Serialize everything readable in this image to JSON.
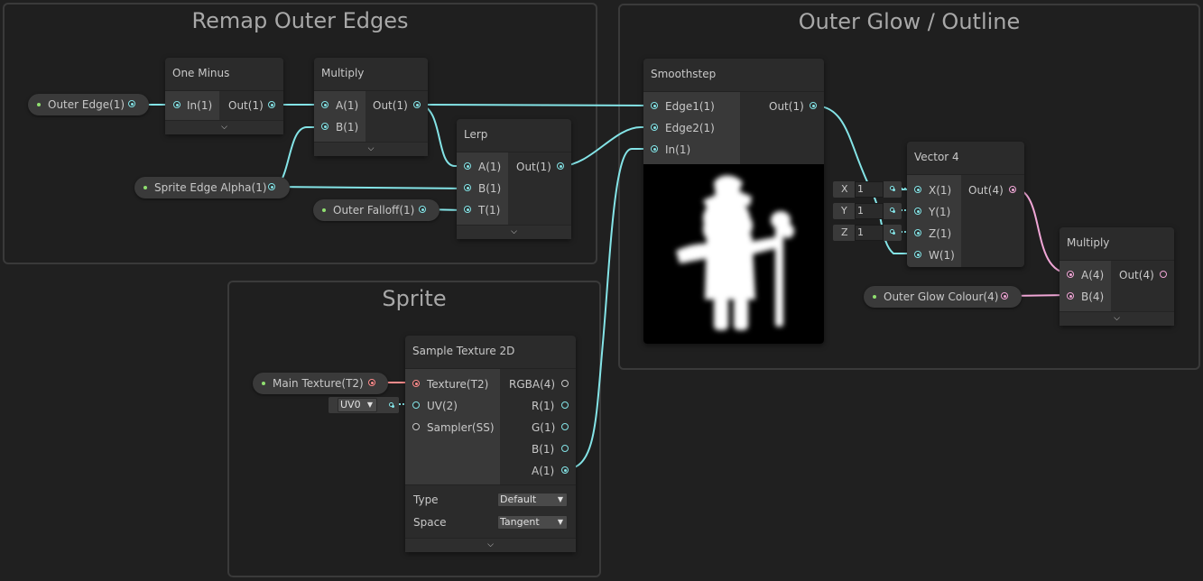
{
  "groups": {
    "remap": "Remap Outer Edges",
    "glow": "Outer Glow / Outline",
    "sprite": "Sprite"
  },
  "properties": {
    "outer_edge": "Outer Edge(1)",
    "sprite_edge_alpha": "Sprite Edge Alpha(1)",
    "outer_falloff": "Outer Falloff(1)",
    "main_texture": "Main Texture(T2)",
    "outer_glow_colour": "Outer Glow Colour(4)"
  },
  "nodes": {
    "one_minus": {
      "title": "One Minus",
      "in": "In(1)",
      "out": "Out(1)"
    },
    "multiply1": {
      "title": "Multiply",
      "a": "A(1)",
      "b": "B(1)",
      "out": "Out(1)"
    },
    "lerp": {
      "title": "Lerp",
      "a": "A(1)",
      "b": "B(1)",
      "t": "T(1)",
      "out": "Out(1)"
    },
    "smoothstep": {
      "title": "Smoothstep",
      "edge1": "Edge1(1)",
      "edge2": "Edge2(1)",
      "in": "In(1)",
      "out": "Out(1)"
    },
    "vector4": {
      "title": "Vector 4",
      "x": "X(1)",
      "y": "Y(1)",
      "z": "Z(1)",
      "w": "W(1)",
      "out": "Out(4)",
      "field_x_label": "X",
      "field_x_value": "1",
      "field_y_label": "Y",
      "field_y_value": "1",
      "field_z_label": "Z",
      "field_z_value": "1"
    },
    "multiply2": {
      "title": "Multiply",
      "a": "A(4)",
      "b": "B(4)",
      "out": "Out(4)"
    },
    "sample_texture": {
      "title": "Sample Texture 2D",
      "texture": "Texture(T2)",
      "uv": "UV(2)",
      "sampler": "Sampler(SS)",
      "rgba": "RGBA(4)",
      "r": "R(1)",
      "g": "G(1)",
      "b": "B(1)",
      "a": "A(1)",
      "uv_channel": "UV0",
      "type_label": "Type",
      "type_value": "Default",
      "space_label": "Space",
      "space_value": "Tangent"
    }
  },
  "icons": {
    "expand": "chevron-down-icon",
    "dropdown": "triangle-down-icon"
  },
  "colors": {
    "background": "#202020",
    "node": "#2b2b2b",
    "wire_float": "#84e4e7",
    "wire_vector4": "#f0a6d6",
    "wire_texture": "#ff8c8c",
    "property_dot": "#90e070"
  }
}
